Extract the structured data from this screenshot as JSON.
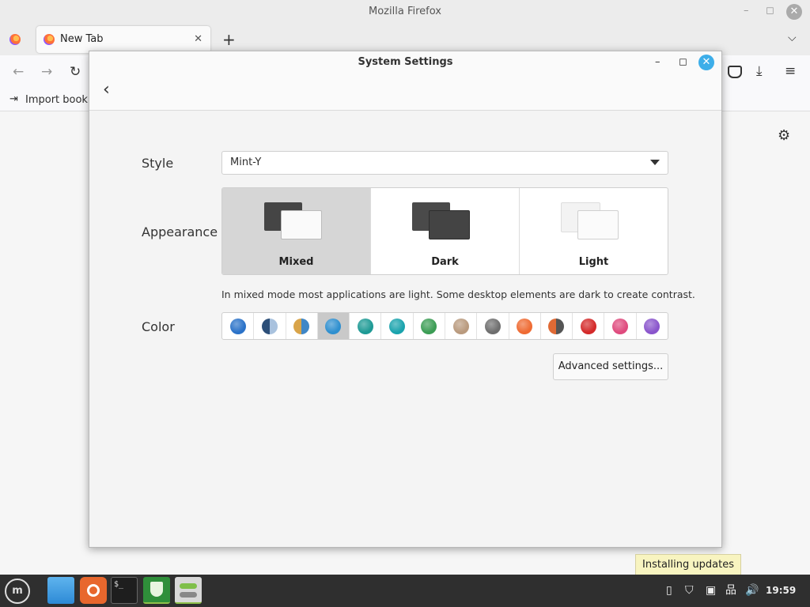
{
  "firefox": {
    "window_title": "Mozilla Firefox",
    "tab_title": "New Tab",
    "tab_close": "✕",
    "new_tab": "+",
    "tab_list": "⌵",
    "bookmark_import": "Import bookm",
    "minimize": "–",
    "maximize": "◻",
    "close": "✕"
  },
  "settings": {
    "window_title": "System Settings",
    "back": "‹",
    "minimize": "–",
    "maximize": "◻",
    "close": "✕",
    "style": {
      "label": "Style",
      "value": "Mint-Y"
    },
    "appearance": {
      "label": "Appearance",
      "options": [
        {
          "label": "Mixed",
          "selected": true
        },
        {
          "label": "Dark",
          "selected": false
        },
        {
          "label": "Light",
          "selected": false
        }
      ]
    },
    "description": "In mixed mode most applications are light. Some desktop elements are dark to create contrast.",
    "color": {
      "label": "Color",
      "swatches": [
        {
          "name": "blue",
          "colors": [
            "#2a72c8"
          ],
          "selected": false
        },
        {
          "name": "dark-blue-split",
          "colors": [
            "#2c4f78",
            "#a9c2de"
          ],
          "selected": false
        },
        {
          "name": "orange-blue-split",
          "colors": [
            "#d9a449",
            "#3f87c7"
          ],
          "selected": false
        },
        {
          "name": "aqua",
          "colors": [
            "#2e8fcf"
          ],
          "selected": true
        },
        {
          "name": "teal",
          "colors": [
            "#1e9a95"
          ],
          "selected": false
        },
        {
          "name": "cyan",
          "colors": [
            "#1aa3ad"
          ],
          "selected": false
        },
        {
          "name": "green",
          "colors": [
            "#3c9d55"
          ],
          "selected": false
        },
        {
          "name": "sand",
          "colors": [
            "#b99a7e"
          ],
          "selected": false
        },
        {
          "name": "grey",
          "colors": [
            "#6e6e6e"
          ],
          "selected": false
        },
        {
          "name": "orange",
          "colors": [
            "#ef6b33"
          ],
          "selected": false
        },
        {
          "name": "orange-grey-split",
          "colors": [
            "#e06a35",
            "#555555"
          ],
          "selected": false
        },
        {
          "name": "red",
          "colors": [
            "#d42a2a"
          ],
          "selected": false
        },
        {
          "name": "pink",
          "colors": [
            "#df4b7e"
          ],
          "selected": false
        },
        {
          "name": "purple",
          "colors": [
            "#8a55cc"
          ],
          "selected": false
        }
      ]
    },
    "advanced_button": "Advanced settings..."
  },
  "taskbar": {
    "clock": "19:59",
    "tooltip": "Installing updates"
  }
}
